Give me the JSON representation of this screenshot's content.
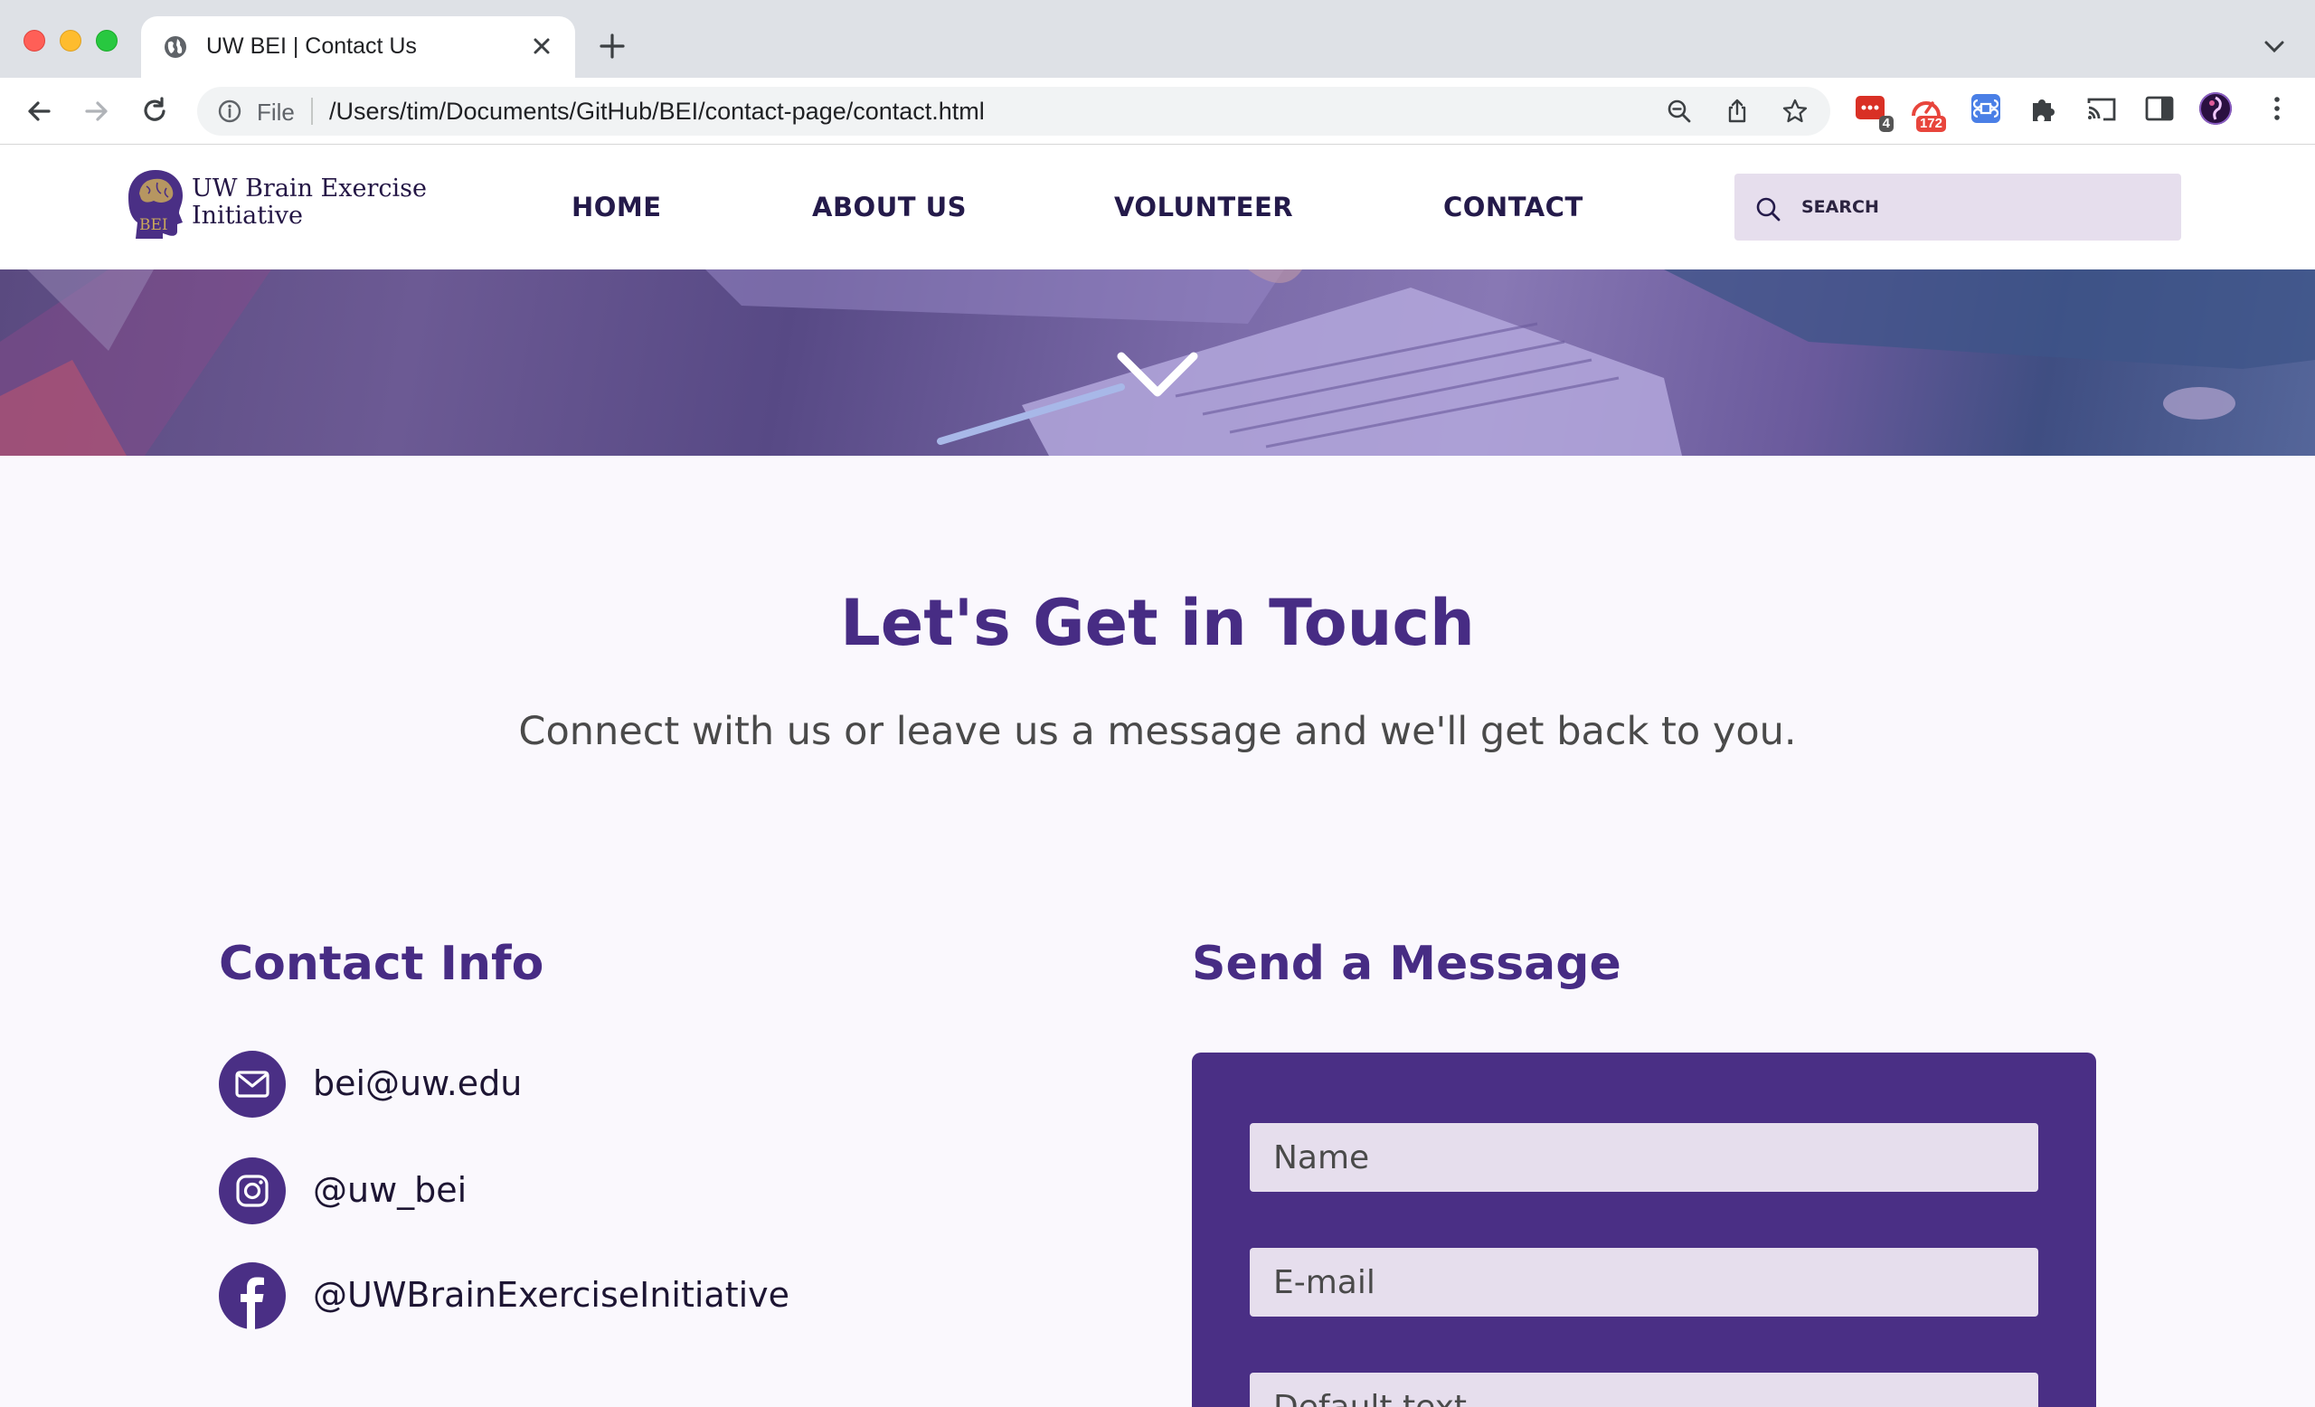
{
  "browser": {
    "tab_title": "UW BEI | Contact Us",
    "file_label": "File",
    "url": "/Users/tim/Documents/GitHub/BEI/contact-page/contact.html",
    "extensions": [
      {
        "name": "messages-extension",
        "badge": "4",
        "color": "#d93025"
      },
      {
        "name": "speed-extension",
        "badge": "172",
        "color": "#e8453c"
      },
      {
        "name": "command-extension",
        "badge": "",
        "color": "#4a7fe6"
      }
    ]
  },
  "site": {
    "logo": {
      "line1": "UW Brain Exercise",
      "line2": "Initiative",
      "mark_text": "BEI"
    },
    "nav": [
      "HOME",
      "ABOUT US",
      "VOLUNTEER",
      "CONTACT"
    ],
    "search_placeholder": "SEARCH"
  },
  "page": {
    "headline": "Let's Get in Touch",
    "subline": "Connect with us or leave us a message and we'll get back to you.",
    "contact_title": "Contact Info",
    "message_title": "Send a Message",
    "contacts": [
      {
        "icon": "mail-icon",
        "text": "bei@uw.edu"
      },
      {
        "icon": "instagram-icon",
        "text": "@uw_bei"
      },
      {
        "icon": "facebook-icon",
        "text": "@UWBrainExerciseInitiative"
      }
    ],
    "form": {
      "name_placeholder": "Name",
      "email_placeholder": "E-mail",
      "message_placeholder": "Default text"
    }
  },
  "colors": {
    "brand_purple": "#4a2f85",
    "heading_purple": "#472c84",
    "field_bg": "#e6deed",
    "page_bg": "#faf8fd"
  }
}
